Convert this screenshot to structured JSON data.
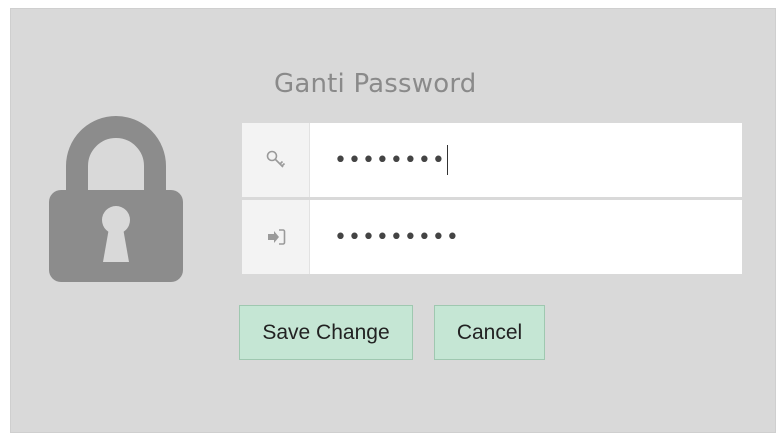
{
  "form": {
    "title": "Ganti Password",
    "old_password_value": "••••••••",
    "new_password_value": "•••••••••"
  },
  "buttons": {
    "save_label": "Save Change",
    "cancel_label": "Cancel"
  },
  "icons": {
    "lock": "lock-icon",
    "key": "key-icon",
    "login": "sign-in-icon"
  },
  "colors": {
    "panel_bg": "#d9d9d9",
    "button_bg": "#c5e6d4",
    "lock_gray": "#8c8c8c"
  }
}
